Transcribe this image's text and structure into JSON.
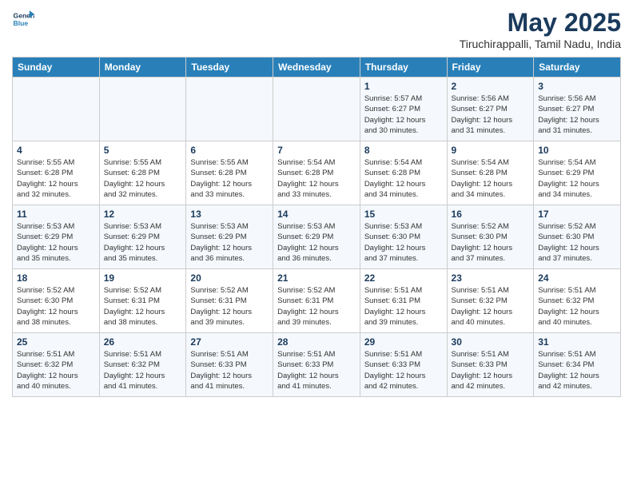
{
  "header": {
    "logo_line1": "General",
    "logo_line2": "Blue",
    "title": "May 2025",
    "subtitle": "Tiruchirappalli, Tamil Nadu, India"
  },
  "columns": [
    "Sunday",
    "Monday",
    "Tuesday",
    "Wednesday",
    "Thursday",
    "Friday",
    "Saturday"
  ],
  "weeks": [
    [
      {
        "day": "",
        "info": ""
      },
      {
        "day": "",
        "info": ""
      },
      {
        "day": "",
        "info": ""
      },
      {
        "day": "",
        "info": ""
      },
      {
        "day": "1",
        "info": "Sunrise: 5:57 AM\nSunset: 6:27 PM\nDaylight: 12 hours\nand 30 minutes."
      },
      {
        "day": "2",
        "info": "Sunrise: 5:56 AM\nSunset: 6:27 PM\nDaylight: 12 hours\nand 31 minutes."
      },
      {
        "day": "3",
        "info": "Sunrise: 5:56 AM\nSunset: 6:27 PM\nDaylight: 12 hours\nand 31 minutes."
      }
    ],
    [
      {
        "day": "4",
        "info": "Sunrise: 5:55 AM\nSunset: 6:28 PM\nDaylight: 12 hours\nand 32 minutes."
      },
      {
        "day": "5",
        "info": "Sunrise: 5:55 AM\nSunset: 6:28 PM\nDaylight: 12 hours\nand 32 minutes."
      },
      {
        "day": "6",
        "info": "Sunrise: 5:55 AM\nSunset: 6:28 PM\nDaylight: 12 hours\nand 33 minutes."
      },
      {
        "day": "7",
        "info": "Sunrise: 5:54 AM\nSunset: 6:28 PM\nDaylight: 12 hours\nand 33 minutes."
      },
      {
        "day": "8",
        "info": "Sunrise: 5:54 AM\nSunset: 6:28 PM\nDaylight: 12 hours\nand 34 minutes."
      },
      {
        "day": "9",
        "info": "Sunrise: 5:54 AM\nSunset: 6:28 PM\nDaylight: 12 hours\nand 34 minutes."
      },
      {
        "day": "10",
        "info": "Sunrise: 5:54 AM\nSunset: 6:29 PM\nDaylight: 12 hours\nand 34 minutes."
      }
    ],
    [
      {
        "day": "11",
        "info": "Sunrise: 5:53 AM\nSunset: 6:29 PM\nDaylight: 12 hours\nand 35 minutes."
      },
      {
        "day": "12",
        "info": "Sunrise: 5:53 AM\nSunset: 6:29 PM\nDaylight: 12 hours\nand 35 minutes."
      },
      {
        "day": "13",
        "info": "Sunrise: 5:53 AM\nSunset: 6:29 PM\nDaylight: 12 hours\nand 36 minutes."
      },
      {
        "day": "14",
        "info": "Sunrise: 5:53 AM\nSunset: 6:29 PM\nDaylight: 12 hours\nand 36 minutes."
      },
      {
        "day": "15",
        "info": "Sunrise: 5:53 AM\nSunset: 6:30 PM\nDaylight: 12 hours\nand 37 minutes."
      },
      {
        "day": "16",
        "info": "Sunrise: 5:52 AM\nSunset: 6:30 PM\nDaylight: 12 hours\nand 37 minutes."
      },
      {
        "day": "17",
        "info": "Sunrise: 5:52 AM\nSunset: 6:30 PM\nDaylight: 12 hours\nand 37 minutes."
      }
    ],
    [
      {
        "day": "18",
        "info": "Sunrise: 5:52 AM\nSunset: 6:30 PM\nDaylight: 12 hours\nand 38 minutes."
      },
      {
        "day": "19",
        "info": "Sunrise: 5:52 AM\nSunset: 6:31 PM\nDaylight: 12 hours\nand 38 minutes."
      },
      {
        "day": "20",
        "info": "Sunrise: 5:52 AM\nSunset: 6:31 PM\nDaylight: 12 hours\nand 39 minutes."
      },
      {
        "day": "21",
        "info": "Sunrise: 5:52 AM\nSunset: 6:31 PM\nDaylight: 12 hours\nand 39 minutes."
      },
      {
        "day": "22",
        "info": "Sunrise: 5:51 AM\nSunset: 6:31 PM\nDaylight: 12 hours\nand 39 minutes."
      },
      {
        "day": "23",
        "info": "Sunrise: 5:51 AM\nSunset: 6:32 PM\nDaylight: 12 hours\nand 40 minutes."
      },
      {
        "day": "24",
        "info": "Sunrise: 5:51 AM\nSunset: 6:32 PM\nDaylight: 12 hours\nand 40 minutes."
      }
    ],
    [
      {
        "day": "25",
        "info": "Sunrise: 5:51 AM\nSunset: 6:32 PM\nDaylight: 12 hours\nand 40 minutes."
      },
      {
        "day": "26",
        "info": "Sunrise: 5:51 AM\nSunset: 6:32 PM\nDaylight: 12 hours\nand 41 minutes."
      },
      {
        "day": "27",
        "info": "Sunrise: 5:51 AM\nSunset: 6:33 PM\nDaylight: 12 hours\nand 41 minutes."
      },
      {
        "day": "28",
        "info": "Sunrise: 5:51 AM\nSunset: 6:33 PM\nDaylight: 12 hours\nand 41 minutes."
      },
      {
        "day": "29",
        "info": "Sunrise: 5:51 AM\nSunset: 6:33 PM\nDaylight: 12 hours\nand 42 minutes."
      },
      {
        "day": "30",
        "info": "Sunrise: 5:51 AM\nSunset: 6:33 PM\nDaylight: 12 hours\nand 42 minutes."
      },
      {
        "day": "31",
        "info": "Sunrise: 5:51 AM\nSunset: 6:34 PM\nDaylight: 12 hours\nand 42 minutes."
      }
    ]
  ]
}
